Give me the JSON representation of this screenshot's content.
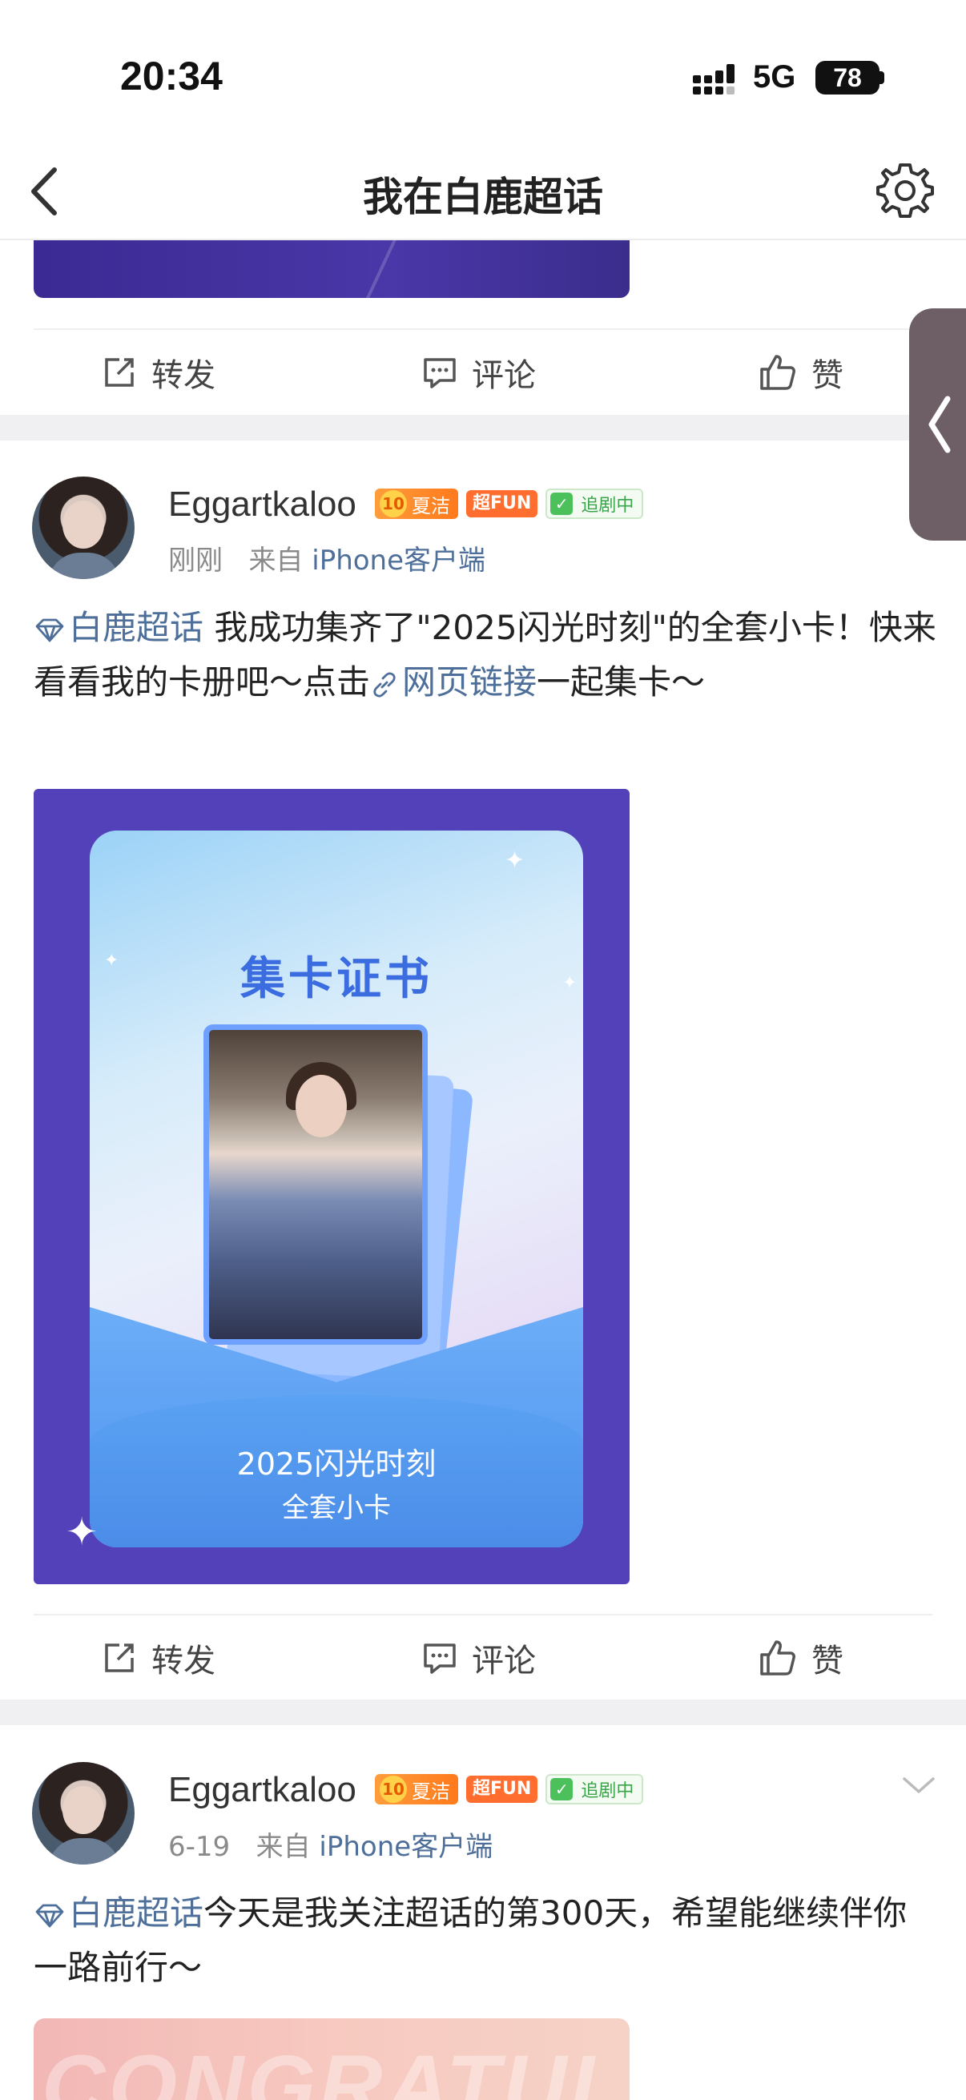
{
  "status_bar": {
    "time": "20:34",
    "network": "5G",
    "battery": "78"
  },
  "nav": {
    "title": "我在白鹿超话",
    "back_icon": "chevron-left-icon",
    "settings_icon": "gear-icon"
  },
  "actions": {
    "repost": "转发",
    "comment": "评论",
    "like": "赞"
  },
  "posts": [
    {
      "username": "Eggartkaloo",
      "badge_level": "10",
      "badge_level_label": "夏洁",
      "badge_fun": "超FUN",
      "badge_follow": "追剧中",
      "time": "刚刚",
      "source_prefix": "来自",
      "source": "iPhone客户端",
      "topic": "白鹿超话",
      "text_1": " 我成功集齐了\"2025闪光时刻\"的全套小卡！快来看看我的卡册吧～点击",
      "link": "网页链接",
      "text_2": "一起集卡～",
      "card": {
        "title": "集卡证书",
        "subtitle": "2025闪光时刻",
        "subtitle2": "全套小卡"
      }
    },
    {
      "username": "Eggartkaloo",
      "badge_level": "10",
      "badge_level_label": "夏洁",
      "badge_fun": "超FUN",
      "badge_follow": "追剧中",
      "time": "6-19",
      "source_prefix": "来自",
      "source": "iPhone客户端",
      "topic": "白鹿超话",
      "text_1": "今天是我关注超话的第300天，希望能继续伴你一路前行～",
      "image_text": "CONGRATULATE"
    }
  ]
}
